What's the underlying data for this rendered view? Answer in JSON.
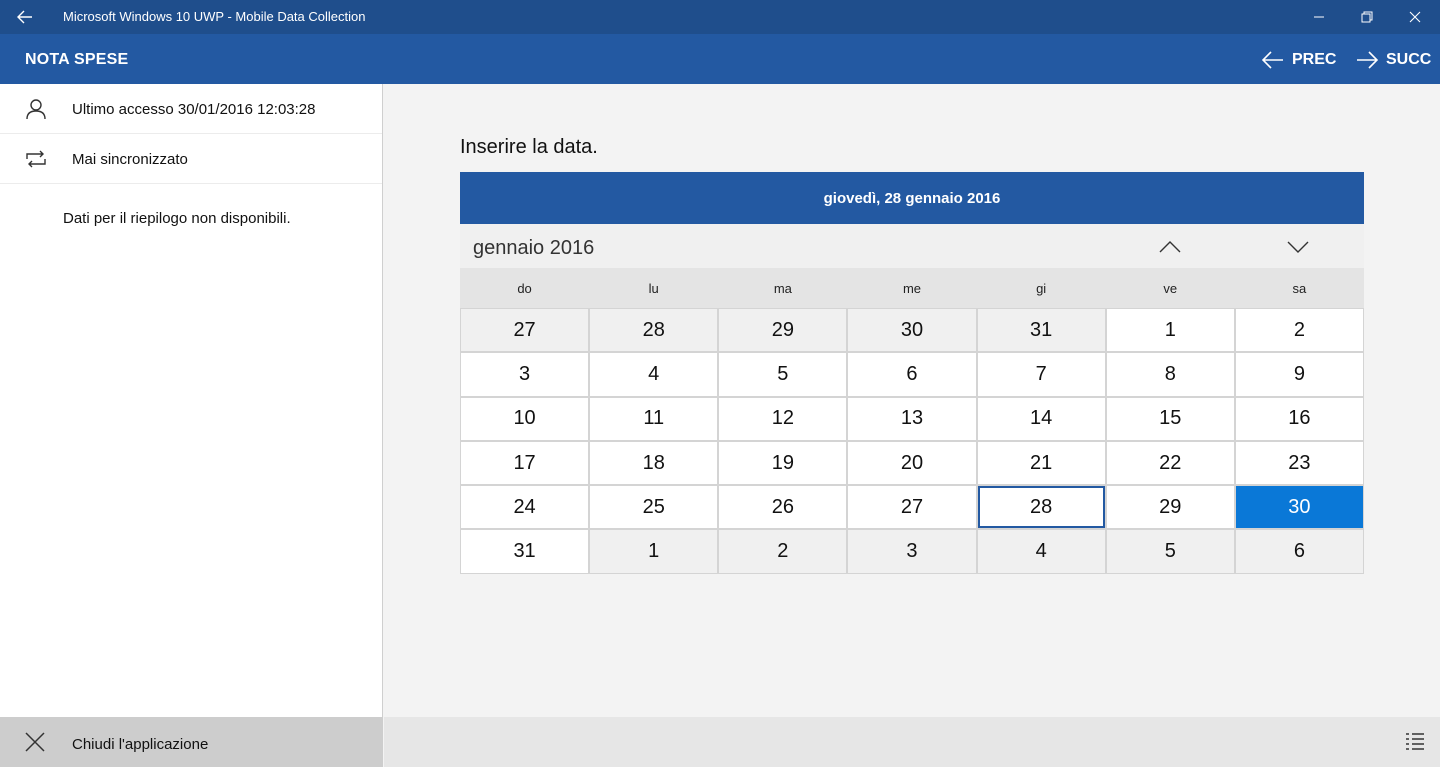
{
  "window": {
    "title": "Microsoft Windows 10 UWP - Mobile Data Collection"
  },
  "header": {
    "title": "NOTA SPESE",
    "prev_label": "PREC",
    "next_label": "SUCC"
  },
  "sidebar": {
    "last_access": "Ultimo accesso 30/01/2016 12:03:28",
    "sync_status": "Mai sincronizzato",
    "summary": "Dati per il riepilogo non disponibili.",
    "close_label": "Chiudi l'applicazione"
  },
  "main": {
    "prompt": "Inserire la data."
  },
  "calendar": {
    "header_date": "giovedì, 28 gennaio 2016",
    "month_label": "gennaio 2016",
    "weekdays": [
      "do",
      "lu",
      "ma",
      "me",
      "gi",
      "ve",
      "sa"
    ],
    "days": [
      {
        "d": "27",
        "other": true
      },
      {
        "d": "28",
        "other": true
      },
      {
        "d": "29",
        "other": true
      },
      {
        "d": "30",
        "other": true
      },
      {
        "d": "31",
        "other": true
      },
      {
        "d": "1"
      },
      {
        "d": "2"
      },
      {
        "d": "3"
      },
      {
        "d": "4"
      },
      {
        "d": "5"
      },
      {
        "d": "6"
      },
      {
        "d": "7"
      },
      {
        "d": "8"
      },
      {
        "d": "9"
      },
      {
        "d": "10"
      },
      {
        "d": "11"
      },
      {
        "d": "12"
      },
      {
        "d": "13"
      },
      {
        "d": "14"
      },
      {
        "d": "15"
      },
      {
        "d": "16"
      },
      {
        "d": "17"
      },
      {
        "d": "18"
      },
      {
        "d": "19"
      },
      {
        "d": "20"
      },
      {
        "d": "21"
      },
      {
        "d": "22"
      },
      {
        "d": "23"
      },
      {
        "d": "24"
      },
      {
        "d": "25"
      },
      {
        "d": "26"
      },
      {
        "d": "27"
      },
      {
        "d": "28",
        "today": true
      },
      {
        "d": "29"
      },
      {
        "d": "30",
        "selected": true
      },
      {
        "d": "31"
      },
      {
        "d": "1",
        "other": true
      },
      {
        "d": "2",
        "other": true
      },
      {
        "d": "3",
        "other": true
      },
      {
        "d": "4",
        "other": true
      },
      {
        "d": "5",
        "other": true
      },
      {
        "d": "6",
        "other": true
      }
    ]
  },
  "colors": {
    "titlebar": "#1f4e8c",
    "accent": "#2359a2",
    "selected": "#0a78d7"
  }
}
